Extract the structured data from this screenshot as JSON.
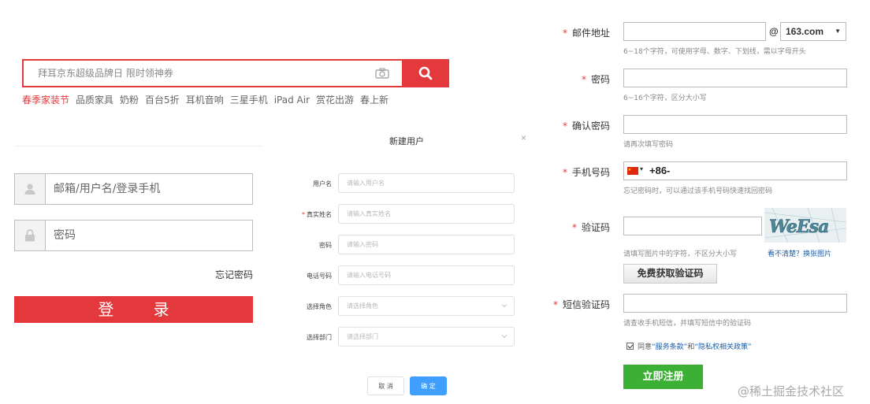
{
  "search": {
    "placeholder": "拜耳京东超级品牌日 限时领神券",
    "hot_words": [
      "春季家装节",
      "品质家具",
      "奶粉",
      "百台5折",
      "耳机音响",
      "三星手机",
      "iPad Air",
      "赏花出游",
      "春上新"
    ]
  },
  "login": {
    "username_placeholder": "邮箱/用户名/登录手机",
    "password_placeholder": "密码",
    "forgot_password": "忘记密码",
    "login_button": "登  录"
  },
  "dialog": {
    "title": "新建用户",
    "close": "×",
    "fields": [
      {
        "label": "用户名",
        "required": false,
        "placeholder": "请输入用户名",
        "type": "input"
      },
      {
        "label": "真实姓名",
        "required": true,
        "placeholder": "请输入真实姓名",
        "type": "input"
      },
      {
        "label": "密码",
        "required": false,
        "placeholder": "请输入密码",
        "type": "input"
      },
      {
        "label": "电话号码",
        "required": false,
        "placeholder": "请输入电话号码",
        "type": "input"
      },
      {
        "label": "选择角色",
        "required": false,
        "placeholder": "请选择角色",
        "type": "select"
      },
      {
        "label": "选择部门",
        "required": false,
        "placeholder": "请选择部门",
        "type": "select"
      }
    ],
    "required_mark": "*",
    "cancel": "取 消",
    "ok": "确 定"
  },
  "register": {
    "required_mark": "*",
    "email_label": "邮件地址",
    "email_at": "@",
    "email_domain": "163.com",
    "email_hint": "6~18个字符，可使用字母、数字、下划线，需以字母开头",
    "password_label": "密码",
    "password_hint": "6~16个字符，区分大小写",
    "confirm_label": "确认密码",
    "confirm_hint": "请再次填写密码",
    "phone_label": "手机号码",
    "phone_code": "+86-",
    "phone_hint": "忘记密码时，可以通过该手机号码快速找回密码",
    "captcha_label": "验证码",
    "captcha_text": "WeEsa",
    "captcha_hint": "请填写图片中的字符，不区分大小写",
    "captcha_refresh": "看不清楚？换张图片",
    "sms_button": "免费获取验证码",
    "sms_label": "短信验证码",
    "sms_hint": "请查收手机短信，并填写短信中的验证码",
    "agree_prefix": "同意",
    "terms_link": "“服务条款”",
    "agree_and": "和",
    "privacy_link": "“隐私权相关政策”",
    "register_button": "立即注册"
  },
  "watermark": "@稀土掘金技术社区",
  "colors": {
    "brand_red": "#e4393c",
    "primary_blue": "#409eff",
    "register_green": "#3cb035",
    "link_blue": "#1a5ca8"
  },
  "icons": [
    "camera-icon",
    "search-icon",
    "user-icon",
    "lock-icon",
    "close-icon",
    "chevron-down-icon",
    "china-flag-icon",
    "checkbox-checked-icon"
  ]
}
